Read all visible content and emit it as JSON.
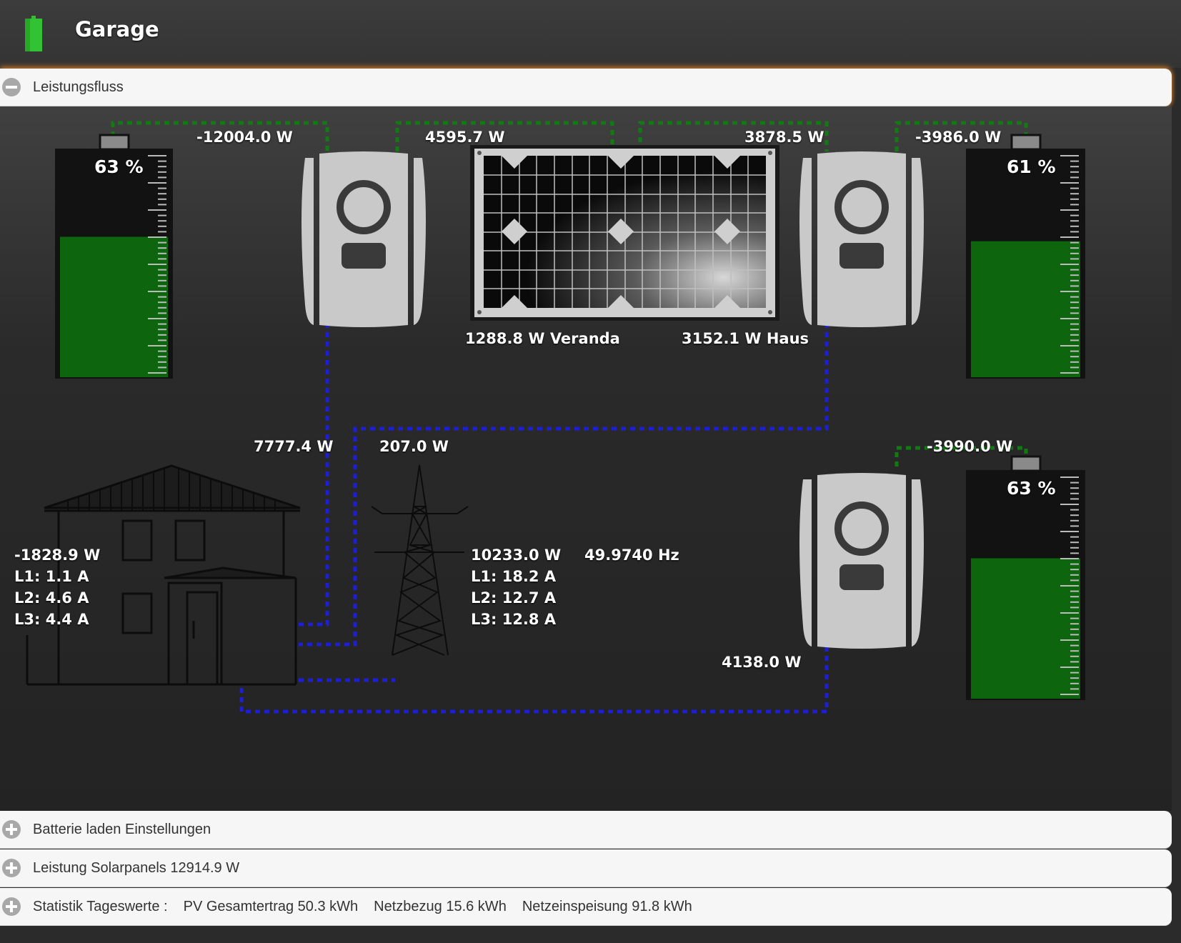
{
  "header": {
    "title": "Garage",
    "icon": "battery-icon"
  },
  "sections": {
    "leistungsfluss": "Leistungsfluss",
    "batterie": "Batterie laden Einstellungen",
    "solar": "Leistung Solarpanels 12914.9 W",
    "statistik": {
      "label": "Statistik Tageswerte :",
      "pv": "PV Gesamtertrag 50.3 kWh",
      "netzbezug": "Netzbezug 15.6 kWh",
      "einspeisung": "Netzeinspeisung 91.8 kWh"
    }
  },
  "flow": {
    "battery_left": {
      "soc_text": "63 %",
      "soc": 0.63,
      "power": "-12004.0 W"
    },
    "battery_right_top": {
      "soc_text": "61 %",
      "soc": 0.61,
      "power": "-3986.0 W"
    },
    "battery_right_bottom": {
      "soc_text": "63 %",
      "soc": 0.63,
      "power": "-3990.0 W"
    },
    "inverter_left_pv": "4595.7 W",
    "inverter_right_pv": "3878.5 W",
    "pv_veranda": "1288.8 W Veranda",
    "pv_haus": "3152.1 W Haus",
    "inverter_left_out": "7777.4 W",
    "inverter_right_out": "207.0 W",
    "inverter_bottom_out": "4138.0 W",
    "house": {
      "power": "-1828.9 W",
      "l1": "L1: 1.1 A",
      "l2": "L2: 4.6 A",
      "l3": "L3: 4.4 A"
    },
    "grid": {
      "power": "10233.0 W",
      "freq": "49.9740 Hz",
      "l1": "L1: 18.2 A",
      "l2": "L2: 12.7 A",
      "l3": "L3: 12.8 A"
    }
  },
  "colors": {
    "dc_line": "#127a12",
    "ac_line": "#1e1ed2",
    "battery_fill": "#0d650d",
    "accent_glow": "#ff9a2a"
  }
}
